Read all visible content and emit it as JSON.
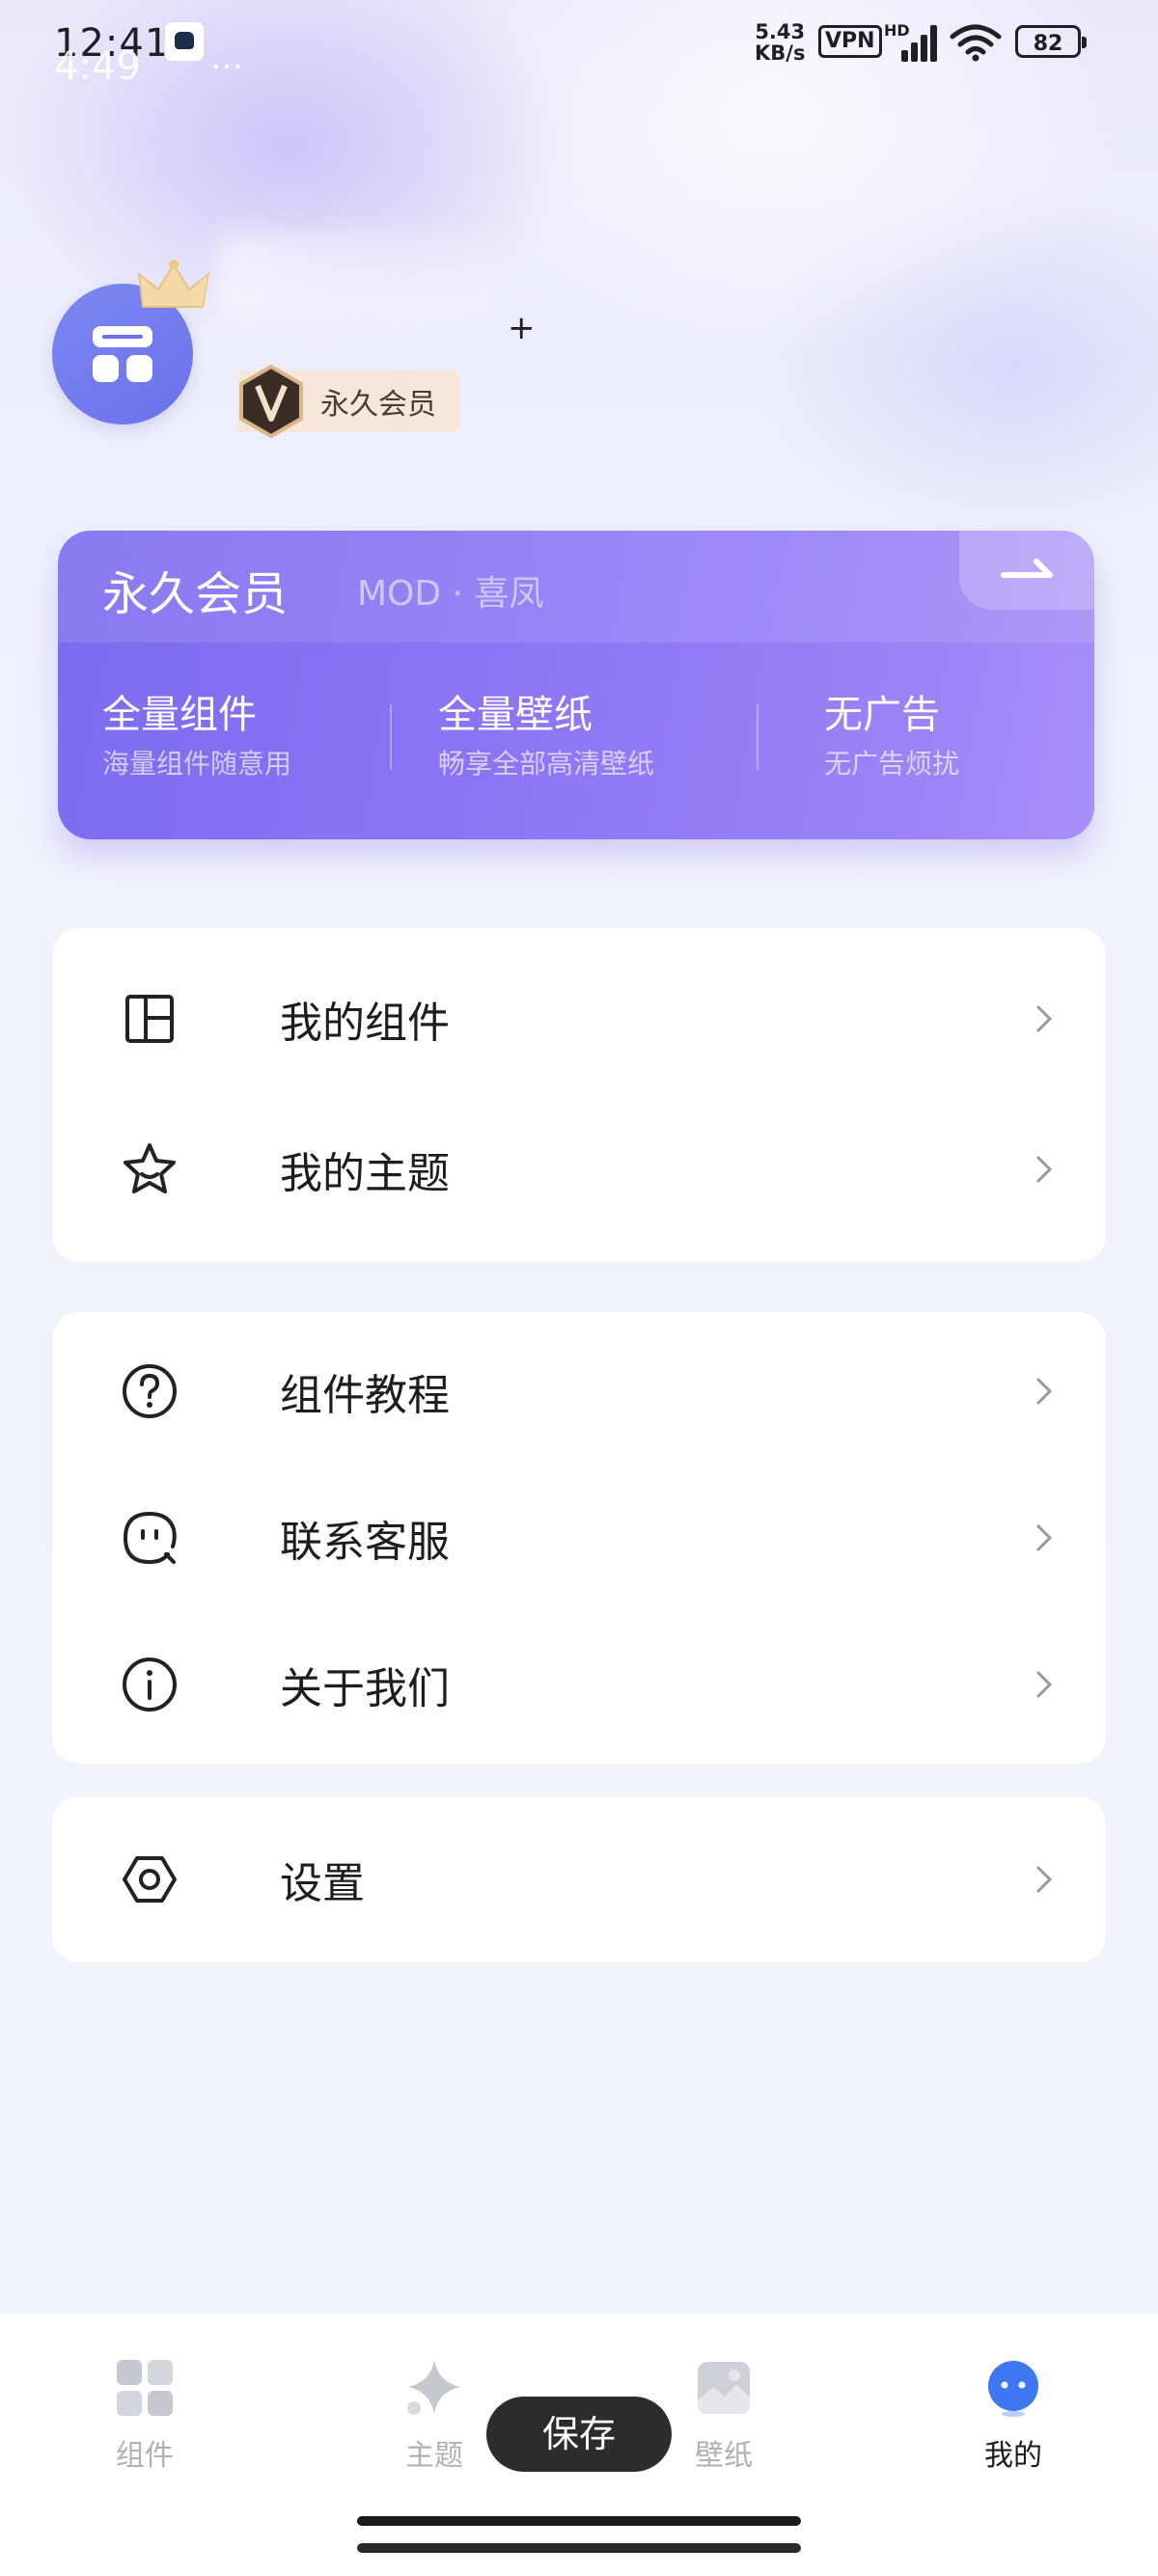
{
  "status_bar": {
    "time": "12:41",
    "time_ghost": "4:49",
    "dots": "…",
    "net_speed_value": "5.43",
    "net_speed_unit": "KB/s",
    "vpn": "VPN",
    "hd": "HD",
    "battery": "82"
  },
  "profile": {
    "plus_mark": "+",
    "member_tag": "永久会员"
  },
  "vip_card": {
    "title": "永久会员",
    "subtitle": "MOD · 喜凤",
    "features": [
      {
        "title": "全量组件",
        "desc": "海量组件随意用"
      },
      {
        "title": "全量壁纸",
        "desc": "畅享全部高清壁纸"
      },
      {
        "title": "无广告",
        "desc": "无广告烦扰"
      }
    ]
  },
  "menu_group_1": [
    {
      "label": "我的组件",
      "icon": "widget-grid-icon"
    },
    {
      "label": "我的主题",
      "icon": "star-icon"
    }
  ],
  "menu_group_2": [
    {
      "label": "组件教程",
      "icon": "help-circle-icon"
    },
    {
      "label": "联系客服",
      "icon": "chat-face-icon"
    },
    {
      "label": "关于我们",
      "icon": "info-circle-icon"
    }
  ],
  "menu_group_3": [
    {
      "label": "设置",
      "icon": "hexagon-settings-icon"
    }
  ],
  "bottom_nav": {
    "items": [
      {
        "label": "组件",
        "icon": "widgets-tab-icon"
      },
      {
        "label": "主题",
        "icon": "theme-sparkle-icon"
      },
      {
        "label": "壁纸",
        "icon": "wallpaper-image-icon"
      },
      {
        "label": "我的",
        "icon": "profile-face-icon",
        "active": true
      }
    ],
    "save_label": "保存"
  },
  "colors": {
    "accent": "#7c6cf0",
    "avatar": "#6f7aee",
    "card_bg": "#ffffff",
    "page_bg": "#f2f4fc"
  }
}
